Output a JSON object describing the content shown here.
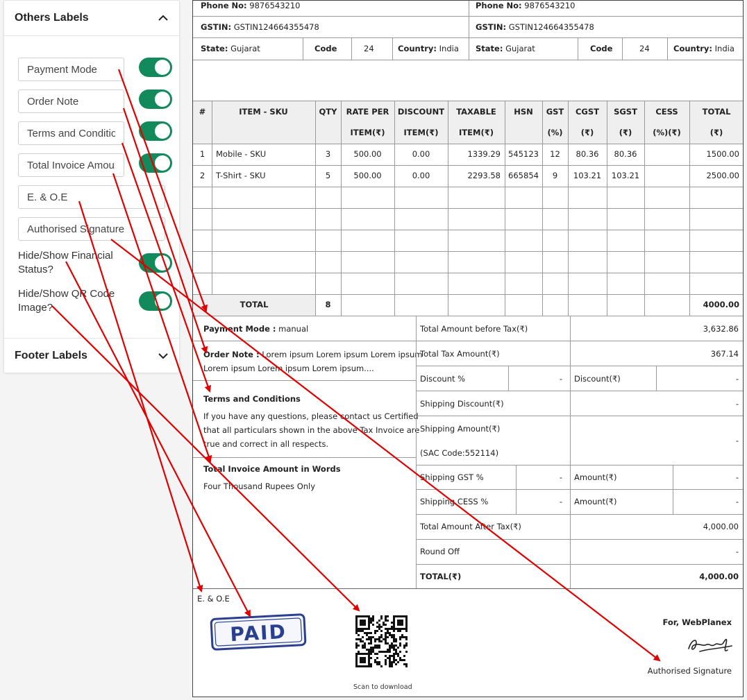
{
  "panel": {
    "others_title": "Others Labels",
    "footer_title": "Footer Labels",
    "inputs": [
      {
        "value": "Payment Mode"
      },
      {
        "value": "Order Note"
      },
      {
        "value": "Terms and Conditions"
      },
      {
        "value": "Total Invoice Amount in Words"
      },
      {
        "value": "E. & O.E"
      },
      {
        "value": "Authorised Signature"
      }
    ],
    "toggle_financial": "Hide/Show Financial Status?",
    "toggle_qr": "Hide/Show QR Code Image?"
  },
  "invoice": {
    "left_party": {
      "phone_label": "Phone No:",
      "phone": "9876543210",
      "gstin_label": "GSTIN:",
      "gstin": "GSTIN124664355478",
      "state_label": "State:",
      "state": "Gujarat",
      "code_label": "Code",
      "code": "24",
      "country_label": "Country:",
      "country": "India"
    },
    "right_party": {
      "phone_label": "Phone No:",
      "phone": "9876543210",
      "gstin_label": "GSTIN:",
      "gstin": "GSTIN124664355478",
      "state_label": "State:",
      "state": "Gujarat",
      "code_label": "Code",
      "code": "24",
      "country_label": "Country:",
      "country": "India"
    },
    "headers": [
      {
        "l1": "#",
        "l2": ""
      },
      {
        "l1": "ITEM - SKU",
        "l2": ""
      },
      {
        "l1": "QTY",
        "l2": ""
      },
      {
        "l1": "RATE PER",
        "l2": "ITEM(₹)"
      },
      {
        "l1": "DISCOUNT",
        "l2": "ITEM(₹)"
      },
      {
        "l1": "TAXABLE",
        "l2": "ITEM(₹)"
      },
      {
        "l1": "HSN",
        "l2": ""
      },
      {
        "l1": "GST",
        "l2": "(%)"
      },
      {
        "l1": "CGST",
        "l2": "(₹)"
      },
      {
        "l1": "SGST",
        "l2": "(₹)"
      },
      {
        "l1": "CESS",
        "l2": "(%)(₹)"
      },
      {
        "l1": "TOTAL",
        "l2": "(₹)"
      }
    ],
    "rows": [
      [
        "1",
        "Mobile - SKU",
        "3",
        "500.00",
        "0.00",
        "1339.29",
        "545123",
        "12",
        "80.36",
        "80.36",
        "",
        "1500.00"
      ],
      [
        "2",
        "T-Shirt - SKU",
        "5",
        "500.00",
        "0.00",
        "2293.58",
        "665854",
        "9",
        "103.21",
        "103.21",
        "",
        "2500.00"
      ]
    ],
    "total_label": "TOTAL",
    "total_qty": "8",
    "total_amount": "4000.00",
    "payment_mode_label": "Payment Mode :",
    "payment_mode": "manual",
    "order_note_label": "Order Note :",
    "order_note_1": "Lorem ipsum Lorem ipsum Lorem ipsum",
    "order_note_2": "Lorem ipsum Lorem ipsum Lorem ipsum....",
    "terms_title": "Terms and Conditions",
    "terms_1": "If you have any questions, please contact us Certified",
    "terms_2": "that all particulars shown in the above Tax Invoice are",
    "terms_3": "true and correct in all respects.",
    "words_title": "Total Invoice Amount in Words",
    "words": "Four Thousand Rupees Only",
    "summary": {
      "before_tax_label": "Total Amount before Tax(₹)",
      "before_tax": "3,632.86",
      "tax_label": "Total Tax Amount(₹)",
      "tax": "367.14",
      "discount_pct_label": "Discount %",
      "discount_pct": "-",
      "discount_amt_label": "Discount(₹)",
      "discount_amt": "-",
      "ship_discount_label": "Shipping Discount(₹)",
      "ship_discount": "-",
      "ship_amount_label": "Shipping Amount(₹)",
      "ship_sac": "(SAC Code:552114)",
      "ship_amount": "-",
      "ship_gst_label": "Shipping GST %",
      "ship_gst": "-",
      "ship_gst_amt_label": "Amount(₹)",
      "ship_gst_amt": "-",
      "ship_cess_label": "Shipping CESS %",
      "ship_cess": "-",
      "ship_cess_amt_label": "Amount(₹)",
      "ship_cess_amt": "-",
      "after_tax_label": "Total Amount After Tax(₹)",
      "after_tax": "4,000.00",
      "round_off_label": "Round Off",
      "round_off": "-",
      "total_label": "TOTAL(₹)",
      "total": "4,000.00"
    },
    "eoe": "E. & O.E",
    "stamp": "PAID",
    "scan_text": "Scan to download",
    "for_company": "For, WebPlanex",
    "signature_label": "Authorised Signature"
  },
  "colors": {
    "toggle_on": "#138a5c",
    "annotation_arrow": "#e00000",
    "stamp": "#2a3f8f"
  }
}
